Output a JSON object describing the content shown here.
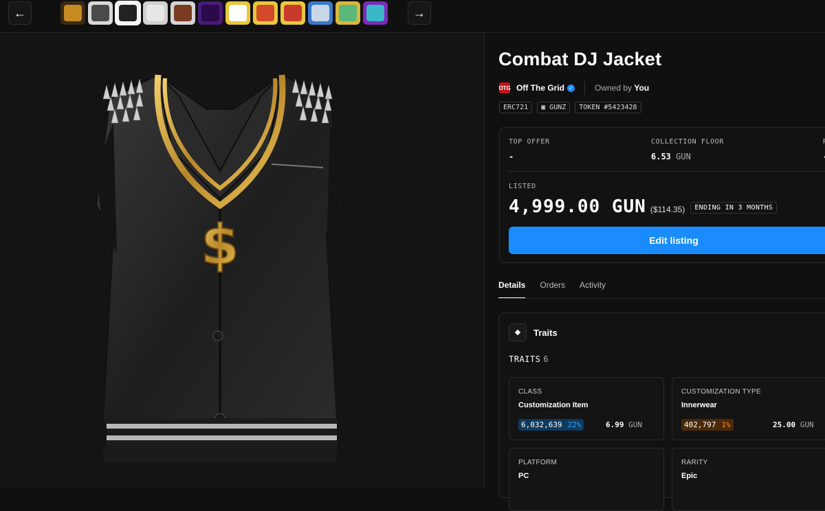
{
  "nav": {
    "prev_label": "←",
    "next_label": "→"
  },
  "thumbnails": [
    {
      "name": "thumb-medal",
      "bg": "#3a2a10",
      "fg": "#c68a22"
    },
    {
      "name": "thumb-backpack",
      "bg": "#d8d8d8",
      "fg": "#4a4a4a"
    },
    {
      "name": "thumb-jacket",
      "bg": "#f4f4f4",
      "fg": "#222222",
      "active": true
    },
    {
      "name": "thumb-blank",
      "bg": "#cfcfcf",
      "fg": "#e6e6e6"
    },
    {
      "name": "thumb-character",
      "bg": "#d4d4d4",
      "fg": "#7a3a22"
    },
    {
      "name": "thumb-purple-gem",
      "bg": "#4a1a7a",
      "fg": "#2a0a4a"
    },
    {
      "name": "thumb-yellow-item",
      "bg": "#e8c83a",
      "fg": "#ffffff"
    },
    {
      "name": "thumb-sausage",
      "bg": "#e8c83a",
      "fg": "#d24a2a"
    },
    {
      "name": "thumb-red-item",
      "bg": "#e8c83a",
      "fg": "#c83a2a"
    },
    {
      "name": "thumb-vehicle",
      "bg": "#3a7ac8",
      "fg": "#c8d8e8"
    },
    {
      "name": "thumb-robot",
      "bg": "#d8b83a",
      "fg": "#5ab87a"
    },
    {
      "name": "thumb-figure",
      "bg": "#7a2ab8",
      "fg": "#3ab8c8"
    }
  ],
  "item": {
    "title": "Combat DJ Jacket"
  },
  "collection": {
    "name": "Off The Grid",
    "owned_prefix": "Owned by",
    "owner": "You"
  },
  "tags": [
    "ERC721",
    "GUNZ",
    "TOKEN #5423428"
  ],
  "pricing": {
    "top_offer_label": "TOP OFFER",
    "top_offer_value": "-",
    "floor_label": "COLLECTION FLOOR",
    "floor_value": "6.53",
    "floor_unit": "GUN",
    "third_label": "R",
    "third_value": "-",
    "listed_label": "LISTED",
    "listed_price": "4,999.00 GUN",
    "listed_usd": "($114.35)",
    "ending": "ENDING IN 3 MONTHS",
    "edit_button": "Edit listing"
  },
  "tabs": [
    "Details",
    "Orders",
    "Activity"
  ],
  "traits": {
    "title": "Traits",
    "count_label": "TRAITS",
    "count": "6",
    "cards": [
      {
        "key": "CLASS",
        "value": "Customization Item",
        "count": "6,032,639",
        "pct": "22%",
        "price": "6.99",
        "unit": "GUN",
        "color": "blue"
      },
      {
        "key": "CUSTOMIZATION TYPE",
        "value": "Innerwear",
        "count": "402,797",
        "pct": "1%",
        "price": "25.00",
        "unit": "GUN",
        "color": "orange"
      },
      {
        "key": "PLATFORM",
        "value": "PC"
      },
      {
        "key": "RARITY",
        "value": "Epic"
      }
    ]
  }
}
